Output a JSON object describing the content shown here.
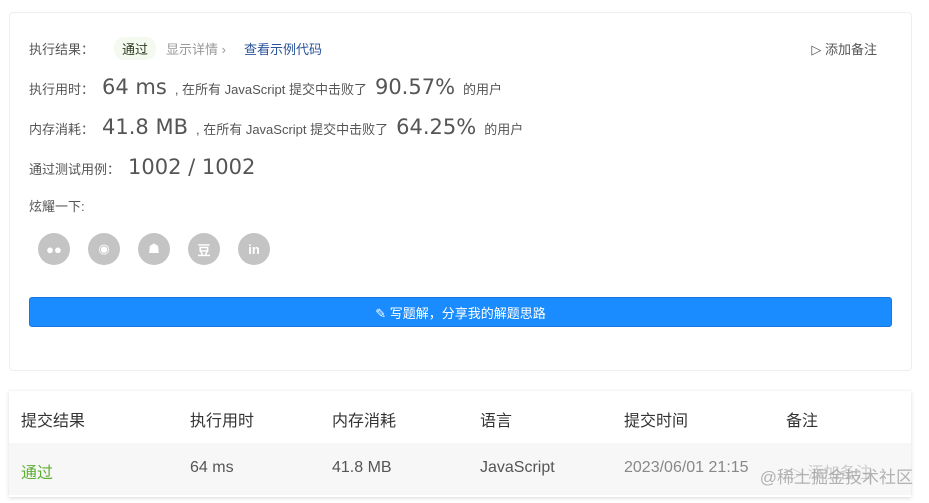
{
  "result": {
    "label": "执行结果：",
    "status": "通过",
    "details": "显示详情 ›",
    "example": "查看示例代码",
    "add_note": "▷ 添加备注"
  },
  "runtime": {
    "label": "执行用时：",
    "value": "64 ms",
    "mid": ", 在所有 JavaScript 提交中击败了",
    "percent": "90.57%",
    "suffix": "的用户"
  },
  "memory": {
    "label": "内存消耗：",
    "value": "41.8 MB",
    "mid": ", 在所有 JavaScript 提交中击败了",
    "percent": "64.25%",
    "suffix": "的用户"
  },
  "tests": {
    "label": "通过测试用例：",
    "value": "1002 / 1002"
  },
  "share": {
    "label": "炫耀一下:",
    "icons": [
      "wechat-icon",
      "weibo-icon",
      "qq-icon",
      "douban-icon",
      "linkedin-icon"
    ]
  },
  "write_button": "✎ 写题解，分享我的解题思路",
  "table": {
    "headers": [
      "提交结果",
      "执行用时",
      "内存消耗",
      "语言",
      "提交时间",
      "备注"
    ],
    "row": {
      "status": "通过",
      "runtime": "64 ms",
      "memory": "41.8 MB",
      "language": "JavaScript",
      "time": "2023/06/01 21:15",
      "note": "▷ 添加备注"
    }
  },
  "watermark": "@稀土掘金技术社区"
}
